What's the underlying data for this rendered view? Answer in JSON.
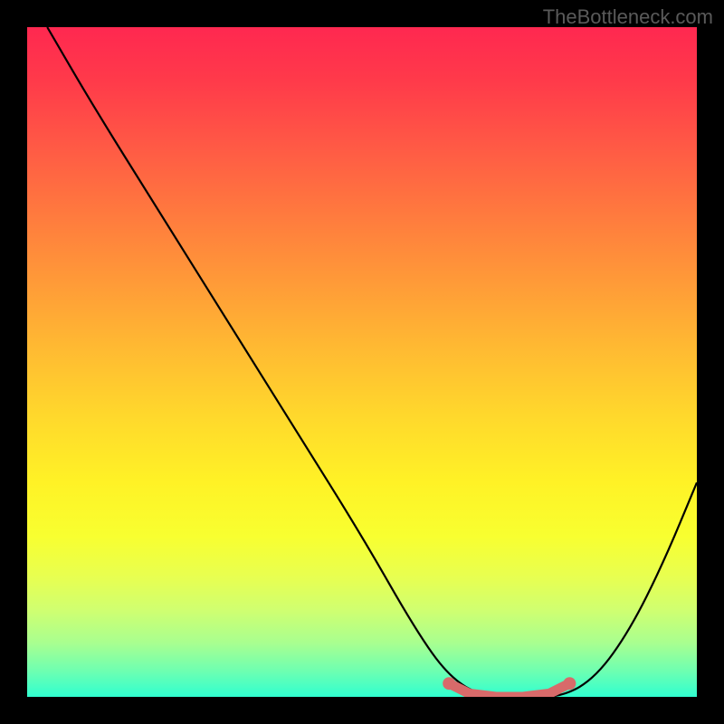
{
  "watermark": "TheBottleneck.com",
  "chart_data": {
    "type": "line",
    "title": "",
    "xlabel": "",
    "ylabel": "",
    "xlim": [
      0,
      100
    ],
    "ylim": [
      0,
      100
    ],
    "series": [
      {
        "name": "bottleneck-curve",
        "x": [
          3,
          10,
          20,
          30,
          40,
          50,
          58,
          63,
          68,
          74,
          80,
          85,
          90,
          95,
          100
        ],
        "y": [
          100,
          88,
          72,
          56,
          40,
          24,
          10,
          3,
          0,
          0,
          0,
          3,
          10,
          20,
          32
        ]
      }
    ],
    "highlight": {
      "name": "optimal-range",
      "x": [
        63,
        66,
        70,
        74,
        78,
        81
      ],
      "y": [
        2,
        0.5,
        0,
        0,
        0.5,
        2
      ],
      "color": "#d86a6a"
    },
    "gradient_stops": [
      {
        "pos": 0,
        "color": "#ff2850"
      },
      {
        "pos": 50,
        "color": "#ffd030"
      },
      {
        "pos": 85,
        "color": "#f0ff40"
      },
      {
        "pos": 100,
        "color": "#30ffd0"
      }
    ]
  }
}
